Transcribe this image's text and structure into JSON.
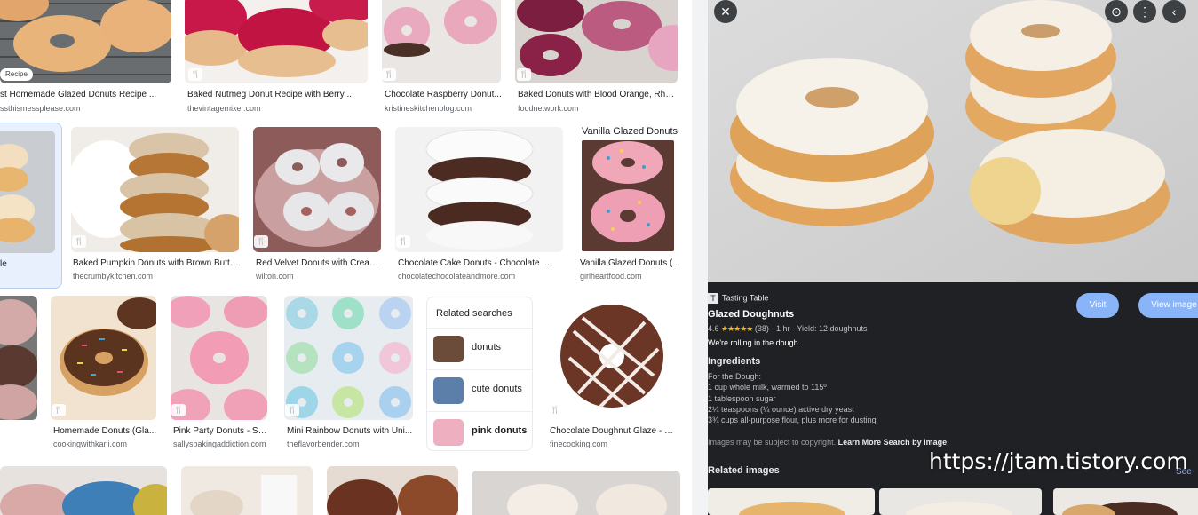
{
  "grid": {
    "row1": [
      {
        "title": "st Homemade Glazed Donuts Recipe ...",
        "source": "ssthismessplease.com",
        "badge": "Recipe"
      },
      {
        "title": "Baked Nutmeg Donut Recipe with Berry ...",
        "source": "thevintagemixer.com"
      },
      {
        "title": "Chocolate Raspberry Donut...",
        "source": "kristineskitchenblog.com"
      },
      {
        "title": "Baked Donuts with Blood Orange, Rhub...",
        "source": "foodnetwork.com"
      }
    ],
    "row2": [
      {
        "title": "le",
        "source": ""
      },
      {
        "title": "Baked Pumpkin Donuts with Brown Butte...",
        "source": "thecrumbykitchen.com"
      },
      {
        "title": "Red Velvet Donuts with Cream...",
        "source": "wilton.com"
      },
      {
        "title": "Chocolate Cake Donuts - Chocolate ...",
        "source": "chocolatechocolateandmore.com"
      },
      {
        "title": "Vanilla Glazed Donuts (...",
        "source": "girlheartfood.com",
        "overlay_label": "Vanilla Glazed Donuts"
      }
    ],
    "row3": [
      {
        "title": "Homemade Donuts (Gla...",
        "source": "cookingwithkarli.com"
      },
      {
        "title": "Pink Party Donuts - Sall...",
        "source": "sallysbakingaddiction.com"
      },
      {
        "title": "Mini Rainbow Donuts with Uni...",
        "source": "theflavorbender.com"
      },
      {
        "title": "Chocolate Doughnut Glaze - Re...",
        "source": "finecooking.com"
      }
    ],
    "fork_icon": "🍴"
  },
  "related_searches": {
    "title": "Related searches",
    "items": [
      {
        "label": "donuts",
        "bold": false
      },
      {
        "label": "cute donuts",
        "bold": false
      },
      {
        "label": "pink donuts",
        "bold": true
      }
    ]
  },
  "panel": {
    "controls": {
      "close": "✕",
      "lens": "⊙",
      "more": "⋮",
      "back": "‹"
    },
    "site_name": "Tasting Table",
    "site_icon": "T",
    "title": "Glazed Doughnuts",
    "rating": "4.6",
    "stars": "★★★★★",
    "reviews": "(38)",
    "time": "1 hr",
    "yield": "Yield: 12 doughnuts",
    "tagline": "We're rolling in the dough.",
    "visit_label": "Visit",
    "view_image_label": "View image",
    "ingredients_heading": "Ingredients",
    "ingredients": [
      "For the Dough:",
      "1 cup whole milk, warmed to 115º",
      "1 tablespoon sugar",
      "2¼ teaspoons (¼ ounce) active dry yeast",
      "3¾ cups all-purpose flour, plus more for dusting"
    ],
    "copyright_text": "Images may be subject to copyright.",
    "learn_more": "Learn More",
    "search_by_image": "Search by image",
    "related_images_heading": "Related images",
    "see_more": "See"
  },
  "watermark": "https://jtam.tistory.com",
  "colors": {
    "panel_bg": "#202124",
    "accent_button": "#8ab4f8",
    "star": "#fbbc04"
  }
}
